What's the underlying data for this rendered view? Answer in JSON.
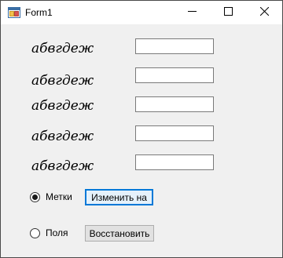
{
  "window": {
    "title": "Form1"
  },
  "titlebar_icons": {
    "app": "form-app-icon",
    "minimize": "minimize-icon",
    "maximize": "maximize-icon",
    "close": "close-icon"
  },
  "samples": [
    {
      "label": "абвгдеж",
      "value": ""
    },
    {
      "label": "абвгдеж",
      "value": ""
    },
    {
      "label": "абвгдеж",
      "value": ""
    },
    {
      "label": "абвгдеж",
      "value": ""
    },
    {
      "label": "абвгдеж",
      "value": ""
    }
  ],
  "options": [
    {
      "label": "Метки",
      "checked": true,
      "button_label": "Изменить на"
    },
    {
      "label": "Поля",
      "checked": false,
      "button_label": "Восстановить"
    }
  ],
  "colors": {
    "focus_accent": "#0078d7",
    "form_background": "#f0f0f0"
  }
}
